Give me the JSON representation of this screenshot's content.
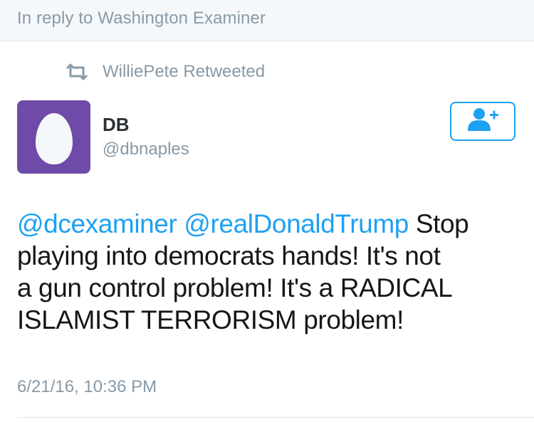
{
  "reply_bar": {
    "text": "In reply to Washington Examiner"
  },
  "retweet": {
    "icon": "retweet-icon",
    "text": "WilliePete Retweeted"
  },
  "author": {
    "display_name": "DB",
    "screen_name": "@dbnaples",
    "avatar_icon": "egg-avatar-icon",
    "avatar_color": "#6e4aa9"
  },
  "follow_button": {
    "icon": "follow-user-plus-icon"
  },
  "tweet": {
    "mention_1": "@dcexaminer",
    "mention_2": "@realDonaldTrump",
    "line_1_text": " Stop",
    "line_2": "playing into democrats hands!  It's not",
    "line_3": "a gun control problem! It's a RADICAL",
    "line_4": "ISLAMIST TERRORISM problem!"
  },
  "timestamp": "6/21/16, 10:36 PM",
  "colors": {
    "accent": "#1da1f2",
    "muted": "#8899a6",
    "text": "#14171a"
  }
}
